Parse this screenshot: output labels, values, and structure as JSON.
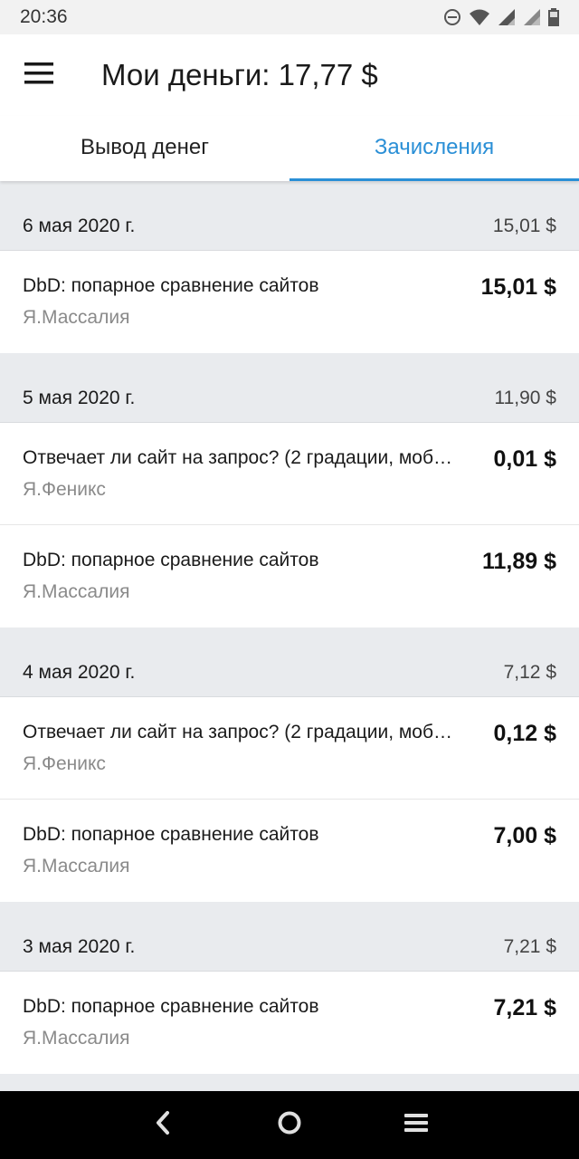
{
  "status_bar": {
    "time": "20:36"
  },
  "app_bar": {
    "title": "Мои деньги: 17,77 $"
  },
  "tabs": [
    {
      "label": "Вывод денег",
      "active": false
    },
    {
      "label": "Зачисления",
      "active": true
    }
  ],
  "days": [
    {
      "date": "6 мая 2020 г.",
      "total": "15,01 $",
      "items": [
        {
          "title": "DbD: попарное сравнение сайтов",
          "requester": "Я.Массалия",
          "amount": "15,01 $"
        }
      ]
    },
    {
      "date": "5 мая 2020 г.",
      "total": "11,90 $",
      "items": [
        {
          "title": "Отвечает ли сайт на запрос? (2 градации, моб…",
          "requester": "Я.Феникс",
          "amount": "0,01 $"
        },
        {
          "title": "DbD: попарное сравнение сайтов",
          "requester": "Я.Массалия",
          "amount": "11,89 $"
        }
      ]
    },
    {
      "date": "4 мая 2020 г.",
      "total": "7,12 $",
      "items": [
        {
          "title": "Отвечает ли сайт на запрос? (2 градации, моб…",
          "requester": "Я.Феникс",
          "amount": "0,12 $"
        },
        {
          "title": "DbD: попарное сравнение сайтов",
          "requester": "Я.Массалия",
          "amount": "7,00 $"
        }
      ]
    },
    {
      "date": "3 мая 2020 г.",
      "total": "7,21 $",
      "items": [
        {
          "title": "DbD: попарное сравнение сайтов",
          "requester": "Я.Массалия",
          "amount": "7,21 $"
        }
      ]
    }
  ],
  "colors": {
    "accent": "#2a8fd6",
    "background": "#e9ebee"
  },
  "icons": {
    "status": [
      "do-not-disturb-icon",
      "wifi-icon",
      "signal-icon",
      "signal-icon",
      "battery-icon"
    ],
    "app_bar": "menu-icon",
    "nav": [
      "back-icon",
      "home-icon",
      "recents-icon"
    ]
  }
}
